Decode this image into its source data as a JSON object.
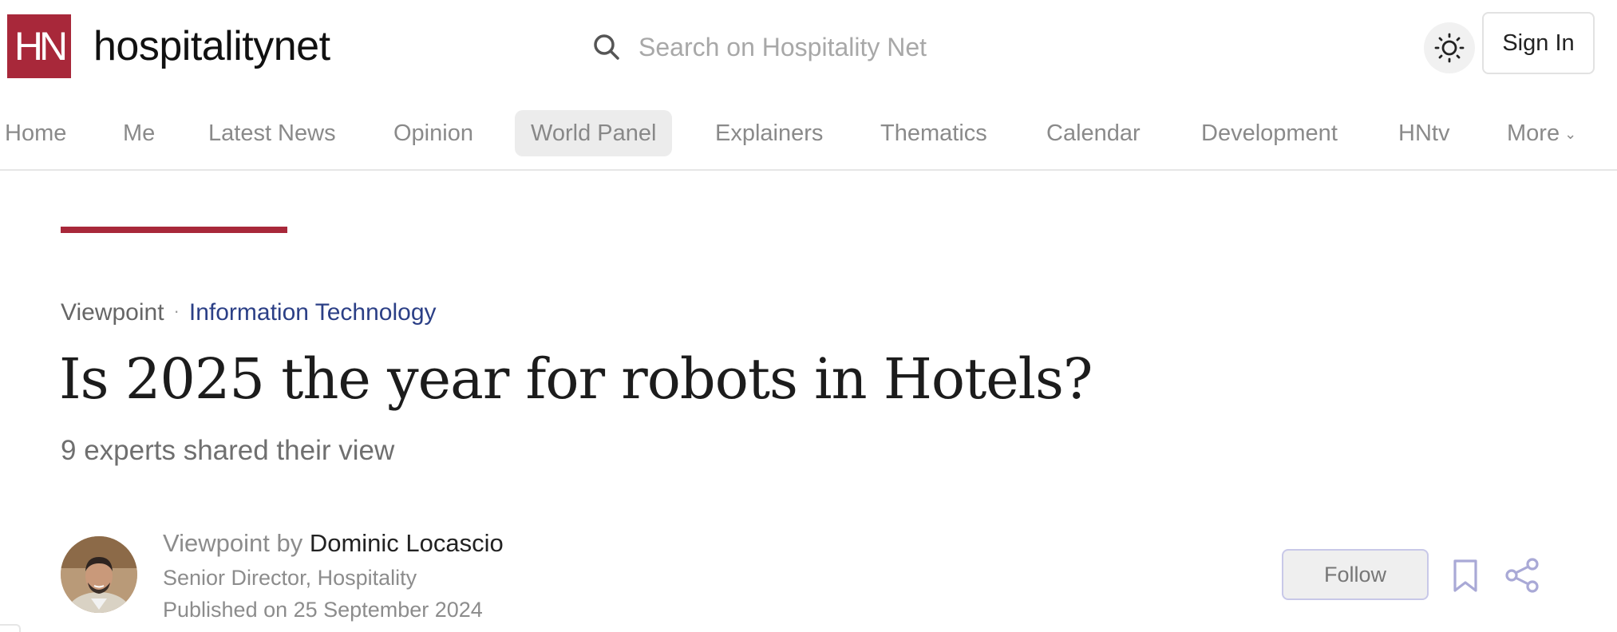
{
  "header": {
    "logo_mark": "HN",
    "logo_text": "hospitalitynet",
    "search_placeholder": "Search on Hospitality Net",
    "sign_in_label": "Sign In"
  },
  "nav": {
    "items": [
      {
        "label": "Home"
      },
      {
        "label": "Me"
      },
      {
        "label": "Latest News"
      },
      {
        "label": "Opinion"
      },
      {
        "label": "World Panel",
        "active": true
      },
      {
        "label": "Explainers"
      },
      {
        "label": "Thematics"
      },
      {
        "label": "Calendar"
      },
      {
        "label": "Development"
      },
      {
        "label": "HNtv"
      },
      {
        "label": "More"
      }
    ]
  },
  "article": {
    "type": "Viewpoint",
    "category": "Information Technology",
    "title": "Is 2025 the year for robots in Hotels?",
    "subtitle": "9 experts shared their view"
  },
  "author": {
    "prefix": "Viewpoint by",
    "name": "Dominic Locascio",
    "role": "Senior Director, Hospitality",
    "published": "Published on 25 September 2024",
    "follow_label": "Follow"
  },
  "colors": {
    "brand": "#a8283a",
    "category_link": "#2b3f86",
    "nav_active_bg": "#ececec"
  }
}
